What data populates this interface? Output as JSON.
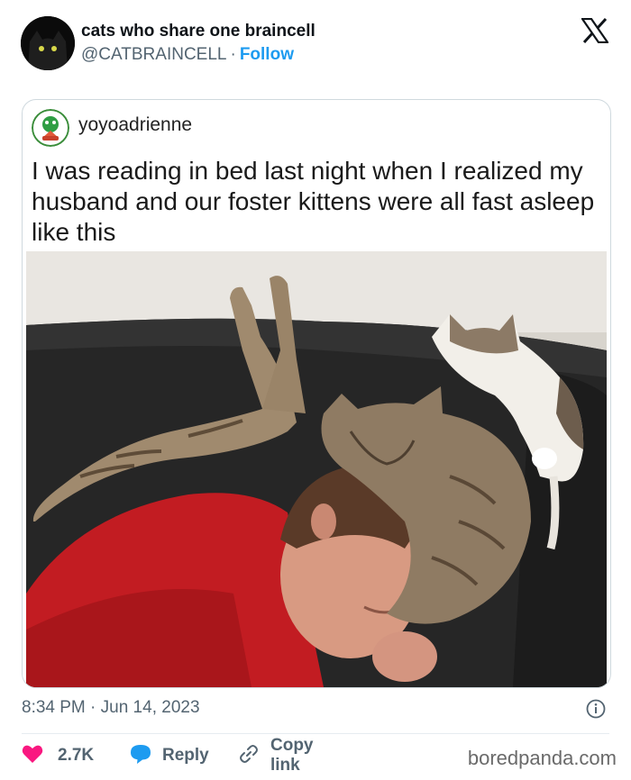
{
  "author": {
    "display_name": "cats who share one braincell",
    "handle": "@CATBRAINCELL",
    "separator": "·",
    "follow_label": "Follow"
  },
  "quoted": {
    "username": "yoyoadrienne",
    "text": "I was reading in bed last night when I realized my husband and our foster kittens were all fast asleep like this",
    "image_label": "man asleep on a dark couch with three kittens sleeping on his head and shoulders"
  },
  "post": {
    "timestamp": "8:34 PM · Jun 14, 2023"
  },
  "actions": {
    "likes": "2.7K",
    "reply_label": "Reply",
    "copy_label": "Copy link"
  },
  "watermark": "boredpanda.com",
  "colors": {
    "brand_blue": "#1d9bf0",
    "like_pink": "#f91880",
    "text_secondary": "#536471",
    "border": "#cfd9de"
  },
  "icons": {
    "x_logo": "x-logo-icon",
    "info": "info-icon",
    "like": "heart-icon",
    "reply": "speech-bubble-icon",
    "copy": "link-icon"
  }
}
